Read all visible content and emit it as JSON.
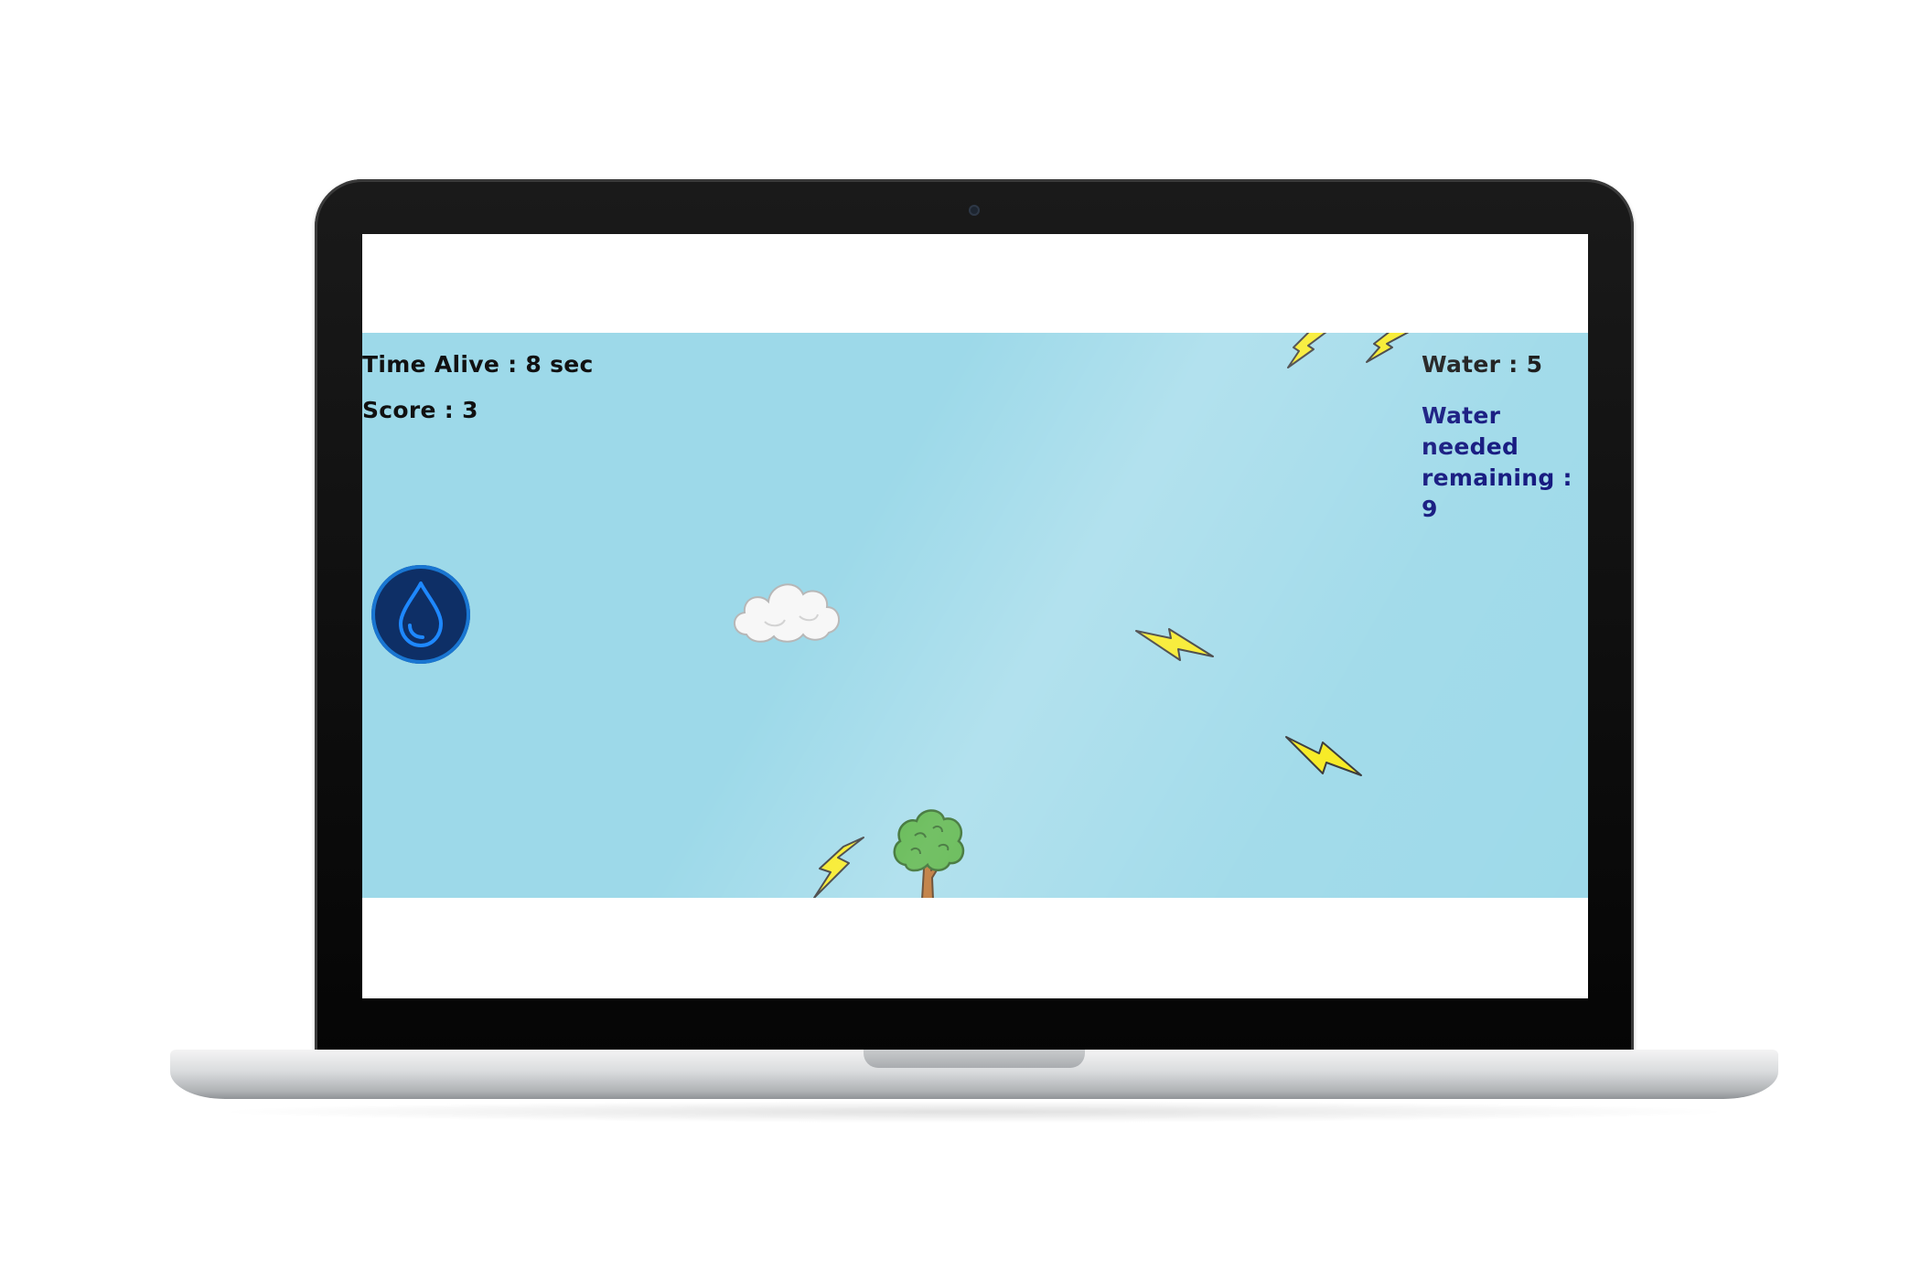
{
  "hud": {
    "time_alive": "Time Alive : 8 sec",
    "score": "Score : 3",
    "water": "Water : 5",
    "water_needed": "Water needed remaining : 9"
  },
  "colors": {
    "sky": "#9dd9e9",
    "needed_text": "#0b0f7a",
    "bolt": "#f7ea1b",
    "button": "#0e2f66",
    "button_ring": "#1976d2"
  },
  "icons": {
    "water_button": "water-drop-icon",
    "cloud": "cloud-icon",
    "tree": "tree-icon",
    "hazard": "lightning-bolt-icon"
  }
}
